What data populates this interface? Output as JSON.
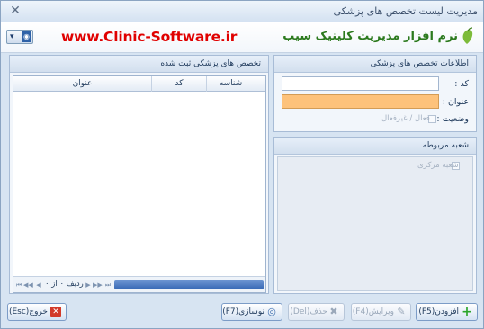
{
  "window": {
    "title": "مدیریت لیست تخصص های پزشکی"
  },
  "header": {
    "url": "www.Clinic-Software.ir",
    "logo_text_main": "نرم افزار مدیریت کلینیک",
    "logo_text_accent": "سیب"
  },
  "grid_panel": {
    "title": "تخصص های پزشکی ثبت شده",
    "columns": [
      "شناسه",
      "کد",
      "عنوان"
    ],
    "rows": [],
    "nav": {
      "record_label": "ردیف ۰ از ۰"
    }
  },
  "info_panel": {
    "title": "اطلاعات تخصص های پزشکی",
    "code_label": "کد :",
    "code_value": "",
    "title_label": "عنوان :",
    "title_value": "",
    "status_label": "وضعیت :",
    "status_option": "فعال / غیرفعال"
  },
  "branch_panel": {
    "title": "شعبه مربوطه",
    "items": [
      {
        "label": "شعبه مرکزی",
        "checked": false
      }
    ]
  },
  "buttons": {
    "add": "افزودن(F5)",
    "edit": "ویرایش(F4)",
    "delete": "حذف(Del)",
    "refresh": "نوسازی(F7)",
    "exit": "خروج(Esc)"
  },
  "colors": {
    "accent_red": "#e00000",
    "orange_field": "#fdc27b",
    "panel_bg": "#d7e4f2",
    "add_icon": "#2aa52a",
    "exit_icon": "#d23a2a"
  },
  "icons": {
    "close": "close-icon",
    "add": "plus-icon",
    "edit": "edit-icon",
    "delete": "delete-x-icon",
    "refresh": "refresh-eye-icon",
    "exit": "exit-icon"
  }
}
